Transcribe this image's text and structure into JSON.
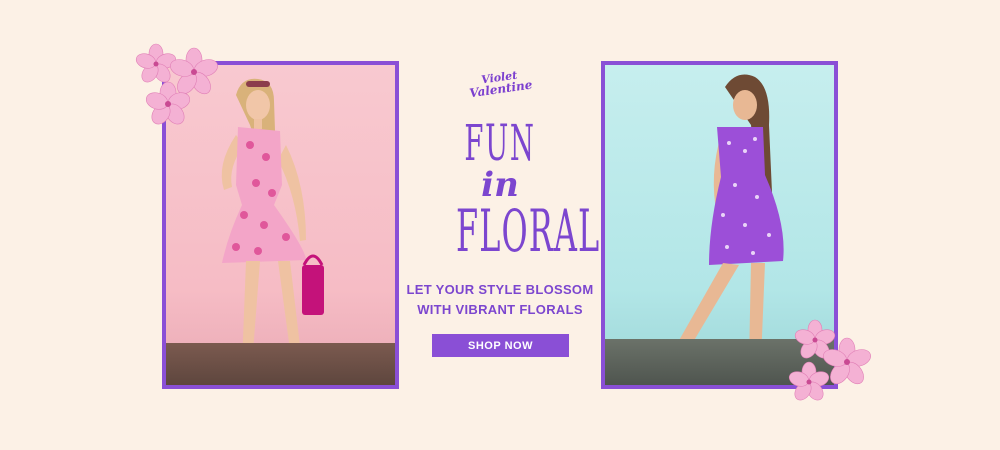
{
  "brand": {
    "logo_line1": "Violet",
    "logo_line2": "Valentine"
  },
  "headline": {
    "line1": "FUN",
    "line2": "in",
    "line3": "FLORAL"
  },
  "tagline": {
    "line1": "LET YOUR STYLE BLOSSOM",
    "line2": "WITH VIBRANT FLORALS"
  },
  "cta": {
    "label": "SHOP NOW"
  },
  "colors": {
    "background": "#fcf1e6",
    "accent_purple": "#8a4fd6",
    "headline_purple": "#7c46cf",
    "flower_pink": "#f2a6d0",
    "left_backdrop": "#f8c9d0",
    "right_backdrop": "#c6eeee"
  },
  "images": {
    "left_photo": "girl-in-pink-floral-dress-photo",
    "right_photo": "girl-in-purple-floral-dress-photo",
    "decor": "pink-hibiscus-flowers-icon"
  }
}
